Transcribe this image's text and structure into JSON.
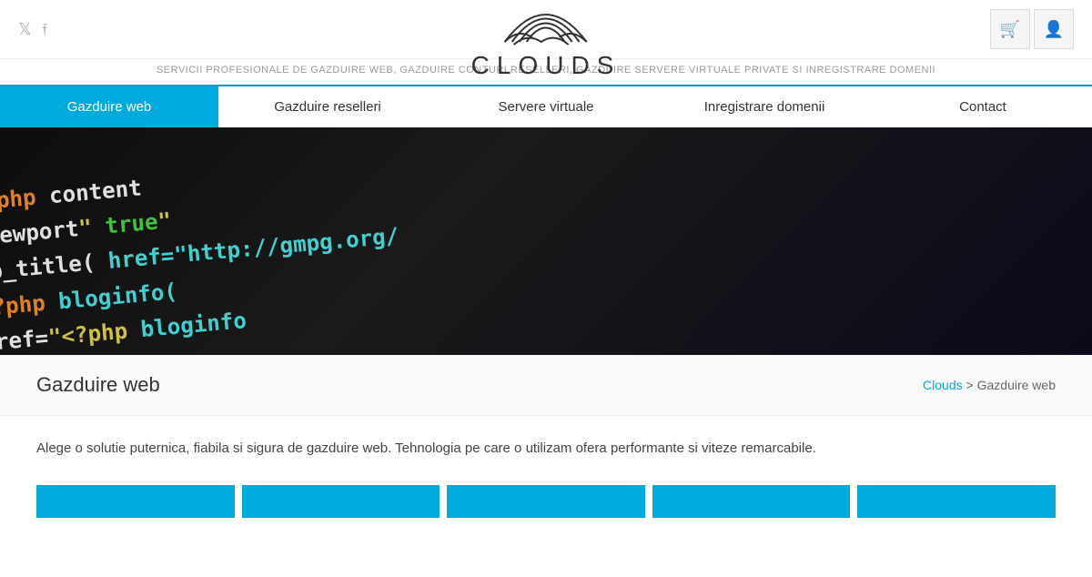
{
  "header": {
    "logo_text": "CLOUDS",
    "tagline": "SERVICII PROFESIONALE DE GAZDUIRE WEB, GAZDUIRE CONTURI RESELLERI, GAZDUIRE SERVERE VIRTUALE PRIVATE SI INREGISTRARE DOMENII"
  },
  "social": {
    "twitter_label": "Twitter",
    "facebook_label": "Facebook"
  },
  "actions": {
    "cart_label": "Cart",
    "account_label": "Account"
  },
  "nav": {
    "items": [
      {
        "id": "gazduire-web",
        "label": "Gazduire web",
        "active": true
      },
      {
        "id": "gazduire-reselleri",
        "label": "Gazduire reselleri",
        "active": false
      },
      {
        "id": "servere-virtuale",
        "label": "Servere virtuale",
        "active": false
      },
      {
        "id": "inregistrare-domenii",
        "label": "Inregistrare domenii",
        "active": false
      },
      {
        "id": "contact",
        "label": "Contact",
        "active": false
      }
    ]
  },
  "page": {
    "title": "Gazduire web",
    "breadcrumb_home": "Clouds",
    "breadcrumb_current": "Gazduire web",
    "description": "Alege o solutie puternica, fiabila si sigura de gazduire web. Tehnologia pe care o utilizam ofera performante si viteze remarcabile."
  }
}
